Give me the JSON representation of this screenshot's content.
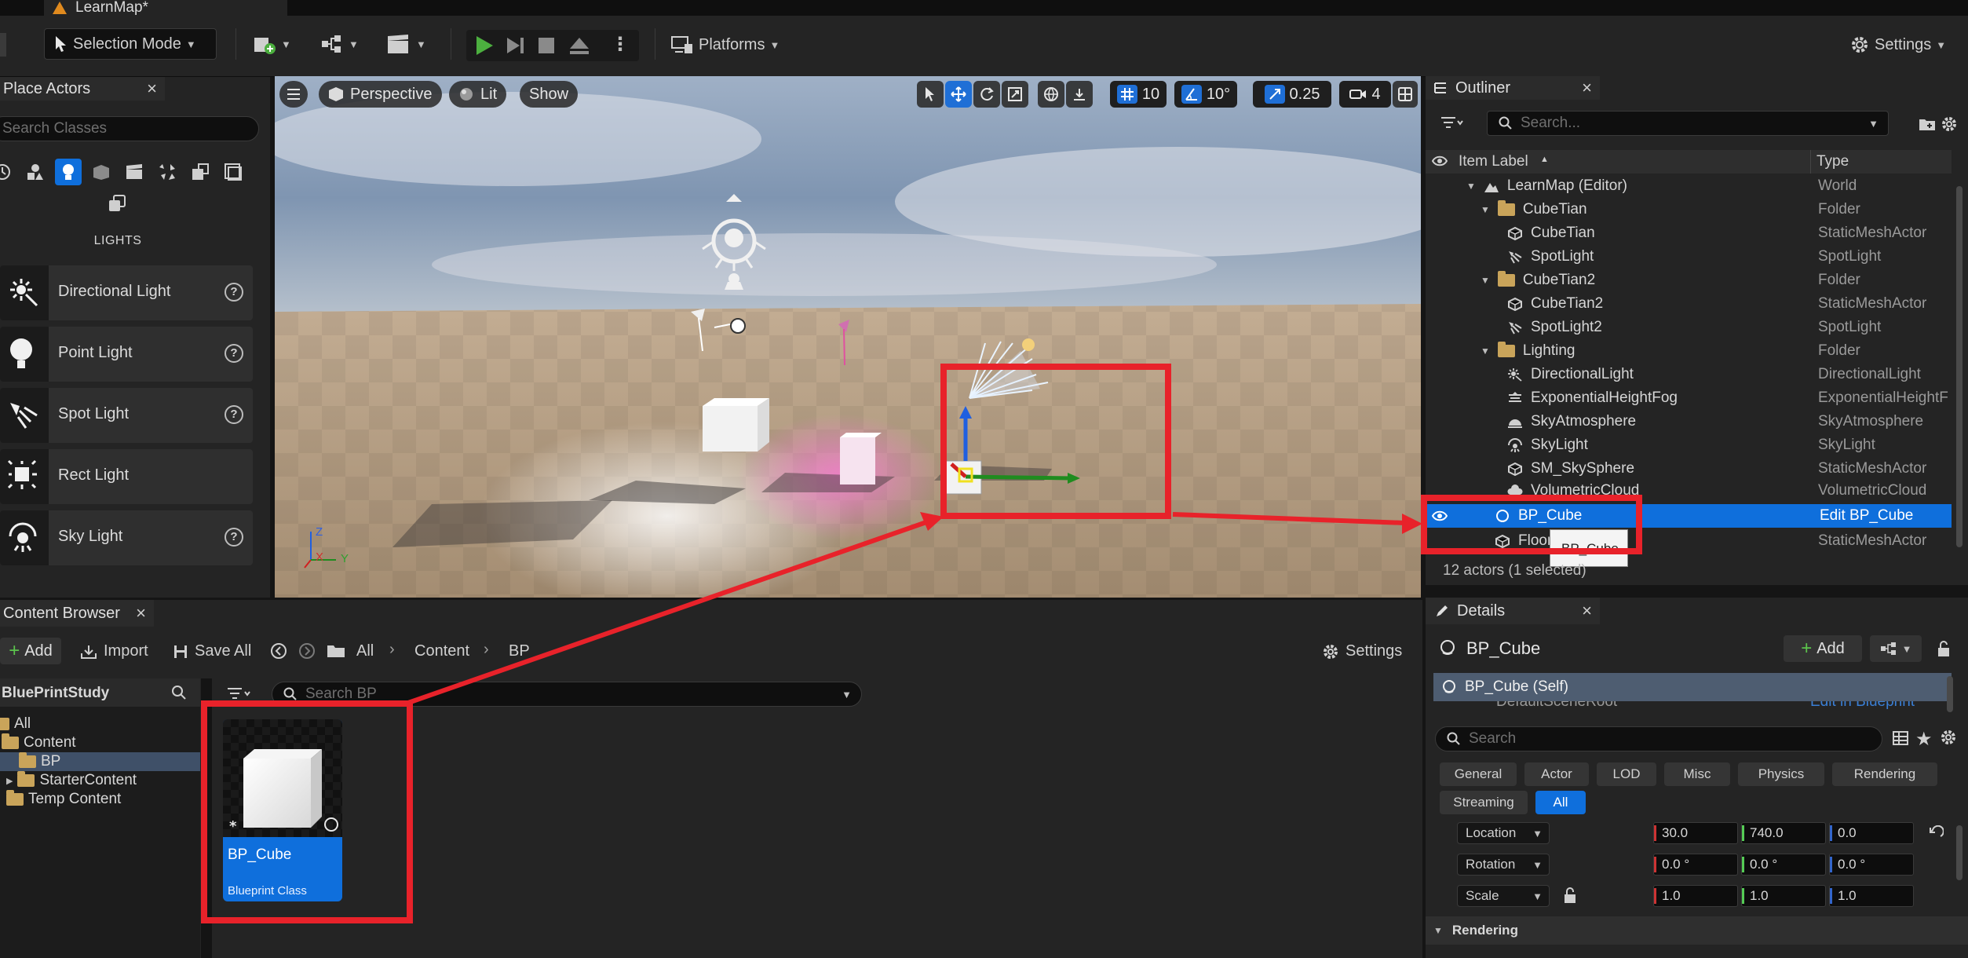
{
  "window": {
    "doc_tab": "LearnMap*"
  },
  "toolbar": {
    "mode": "Selection Mode",
    "platforms": "Platforms",
    "settings": "Settings"
  },
  "place_actors": {
    "tab": "Place Actors",
    "search_placeholder": "Search Classes",
    "category_title": "LIGHTS",
    "items": [
      {
        "label": "Directional Light",
        "icon": "directional-light-icon"
      },
      {
        "label": "Point Light",
        "icon": "point-light-icon"
      },
      {
        "label": "Spot Light",
        "icon": "spot-light-icon"
      },
      {
        "label": "Rect Light",
        "icon": "rect-light-icon"
      },
      {
        "label": "Sky Light",
        "icon": "sky-light-icon"
      }
    ]
  },
  "viewport": {
    "perspective": "Perspective",
    "lit": "Lit",
    "show": "Show",
    "grid_snap": "10",
    "rot_snap": "10°",
    "scale_snap": "0.25",
    "camera_speed": "4",
    "axis_labels": {
      "z": "Z",
      "x": "X",
      "y": "Y"
    }
  },
  "outliner": {
    "tab": "Outliner",
    "search_placeholder": "Search...",
    "col_label": "Item Label",
    "col_type": "Type",
    "rows": [
      {
        "label": "LearnMap (Editor)",
        "type": "World"
      },
      {
        "label": "CubeTian",
        "type": "Folder"
      },
      {
        "label": "CubeTian",
        "type": "StaticMeshActor"
      },
      {
        "label": "SpotLight",
        "type": "SpotLight"
      },
      {
        "label": "CubeTian2",
        "type": "Folder"
      },
      {
        "label": "CubeTian2",
        "type": "StaticMeshActor"
      },
      {
        "label": "SpotLight2",
        "type": "SpotLight"
      },
      {
        "label": "Lighting",
        "type": "Folder"
      },
      {
        "label": "DirectionalLight",
        "type": "DirectionalLight"
      },
      {
        "label": "ExponentialHeightFog",
        "type": "ExponentialHeightF"
      },
      {
        "label": "SkyAtmosphere",
        "type": "SkyAtmosphere"
      },
      {
        "label": "SkyLight",
        "type": "SkyLight"
      },
      {
        "label": "SM_SkySphere",
        "type": "StaticMeshActor"
      },
      {
        "label": "VolumetricCloud",
        "type": "VolumetricCloud"
      },
      {
        "label": "BP_Cube",
        "type": "Edit BP_Cube"
      },
      {
        "label": "Floor",
        "type": "StaticMeshActor"
      }
    ],
    "tooltip": "BP_Cube",
    "status": "12 actors (1 selected)"
  },
  "details": {
    "tab": "Details",
    "actor_name": "BP_Cube",
    "add": "Add",
    "component_self": "BP_Cube (Self)",
    "component_child": "DefaultSceneRoot",
    "component_child_link": "Edit in Blueprint",
    "search_placeholder": "Search",
    "filters": [
      "General",
      "Actor",
      "LOD",
      "Misc",
      "Physics",
      "Rendering",
      "Streaming",
      "All"
    ],
    "transform": [
      {
        "label": "Location",
        "x": "30.0",
        "y": "740.0",
        "z": "0.0"
      },
      {
        "label": "Rotation",
        "x": "0.0 °",
        "y": "0.0 °",
        "z": "0.0 °"
      },
      {
        "label": "Scale",
        "x": "1.0",
        "y": "1.0",
        "z": "1.0"
      }
    ],
    "section_rendering": "Rendering"
  },
  "content_browser": {
    "tab": "Content Browser",
    "add": "Add",
    "import": "Import",
    "save_all": "Save All",
    "breadcrumb": [
      "All",
      "Content",
      "BP"
    ],
    "settings": "Settings",
    "project": "BluePrintStudy",
    "search_placeholder": "Search BP",
    "tree": [
      {
        "label": "All"
      },
      {
        "label": "Content"
      },
      {
        "label": "BP"
      },
      {
        "label": "StarterContent"
      },
      {
        "label": "Temp Content"
      }
    ],
    "asset": {
      "name": "BP_Cube",
      "type": "Blueprint Class"
    }
  },
  "colors": {
    "selection": "#0f6fdc",
    "annotation": "#e8222a",
    "play": "#4caf3f"
  }
}
